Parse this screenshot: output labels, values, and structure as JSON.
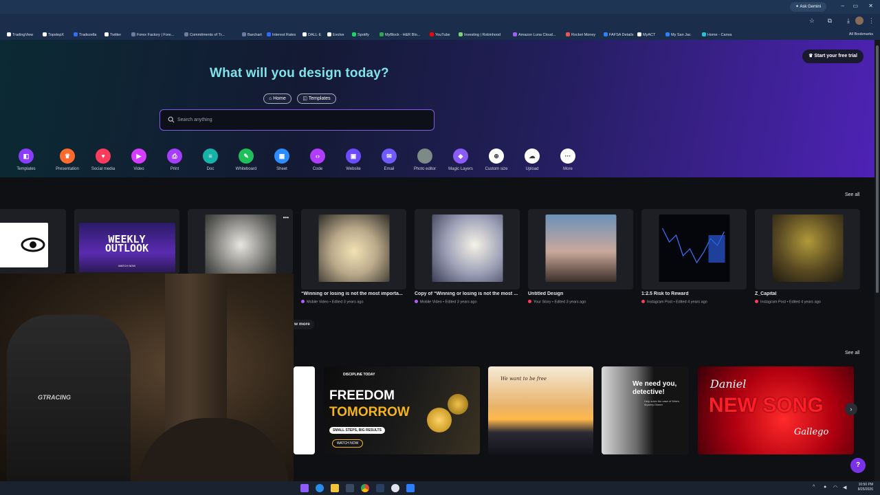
{
  "browser": {
    "gemini_label": "Ask Gemini",
    "window_controls": [
      "–",
      "▭",
      "✕"
    ],
    "bookmarks": [
      "TradingView",
      "TopstepX",
      "Tradezella",
      "Twitter",
      "Forex Factory | Fore...",
      "Commitments of Tr...",
      "Barchart",
      "Interest Rates",
      "DALL·E",
      "Evolve",
      "Spotify",
      "MyBlock - H&R Blo...",
      "YouTube",
      "Investing | Robinhood",
      "Amazon Luna Cloud...",
      "Rocket Money",
      "FAFSA Details",
      "MyACT",
      "My San Jac",
      "Home - Canva"
    ],
    "all_bookmarks": "All Bookmarks"
  },
  "hero": {
    "title": "What will you design today?",
    "trial_label": "Start your free trial",
    "tabs": [
      "Home",
      "Templates"
    ],
    "search_placeholder": "Search anything"
  },
  "categories": [
    {
      "label": "Templates",
      "color": "#8b3dff",
      "glyph": "◧"
    },
    {
      "label": "Presentation",
      "color": "#ff6b2c",
      "glyph": "♛"
    },
    {
      "label": "Social media",
      "color": "#ff3b5c",
      "glyph": "♥"
    },
    {
      "label": "Video",
      "color": "#d43dff",
      "glyph": "▶"
    },
    {
      "label": "Print",
      "color": "#a53dff",
      "glyph": "⎙"
    },
    {
      "label": "Doc",
      "color": "#16b3a8",
      "glyph": "≡"
    },
    {
      "label": "Whiteboard",
      "color": "#1fbf5a",
      "glyph": "✎"
    },
    {
      "label": "Sheet",
      "color": "#2d8cff",
      "glyph": "▦"
    },
    {
      "label": "Code",
      "color": "#b03dff",
      "glyph": "‹›"
    },
    {
      "label": "Website",
      "color": "#6b4dff",
      "glyph": "▣"
    },
    {
      "label": "Email",
      "color": "#6f5bff",
      "glyph": "✉"
    },
    {
      "label": "Photo editor",
      "color": "#7d8b88",
      "glyph": ""
    },
    {
      "label": "Magic Layers",
      "color": "#8b5cf6",
      "glyph": "◆"
    },
    {
      "label": "Custom size",
      "color": "#ffffff",
      "glyph": "⊕"
    },
    {
      "label": "Upload",
      "color": "#ffffff",
      "glyph": "☁"
    },
    {
      "label": "More",
      "color": "#ffffff",
      "glyph": "···"
    }
  ],
  "recent": {
    "see_all": "See all",
    "show_more": "w more",
    "items": [
      {
        "title": "",
        "meta": "",
        "meta_color": ""
      },
      {
        "title": "",
        "meta": "",
        "meta_color": ""
      },
      {
        "title": "",
        "meta": "",
        "meta_color": ""
      },
      {
        "title": "“Winning or losing is not the most importa...",
        "meta": "Mobile Video • Edited 3 years ago",
        "meta_color": "#b05cff"
      },
      {
        "title": "Copy of “Winning or losing is not the most ...",
        "meta": "Mobile Video • Edited 3 years ago",
        "meta_color": "#b05cff"
      },
      {
        "title": "Untitled Design",
        "meta": "Your Story • Edited 3 years ago",
        "meta_color": "#ff3b5c"
      },
      {
        "title": "1:2.5 Risk to Reward",
        "meta": "Instagram Post • Edited 4 years ago",
        "meta_color": "#ff3b5c"
      },
      {
        "title": "Z_Capital",
        "meta": "Instagram Post • Edited 4 years ago",
        "meta_color": "#ff3b5c"
      }
    ],
    "weekly_outlook": [
      "WEEKLY",
      "OUTLOOK"
    ],
    "weekly_small": "WATCH NOW"
  },
  "templates": {
    "see_all": "See all",
    "freedom": {
      "top": "DISCIPLINE TODAY",
      "line1": "FREEDOM",
      "line2": "TOMORROW",
      "sub": "SMALL STEPS, BIG RESULTS",
      "cta": "WATCH NOW"
    },
    "sunset": {
      "script": "We want to be free"
    },
    "detective": {
      "line1": "We need you,",
      "line2": "detective!",
      "sub": "Help solve the case of Mira's Mystery Dinner"
    },
    "song": {
      "name": "Daniel",
      "big": "NEW SONG",
      "sub": "Gallego"
    }
  },
  "webcam": {
    "chair_brand": "GTRACING"
  },
  "taskbar": {
    "time": "10:50 PM",
    "date": "8/25/2026"
  },
  "help_label": "?"
}
